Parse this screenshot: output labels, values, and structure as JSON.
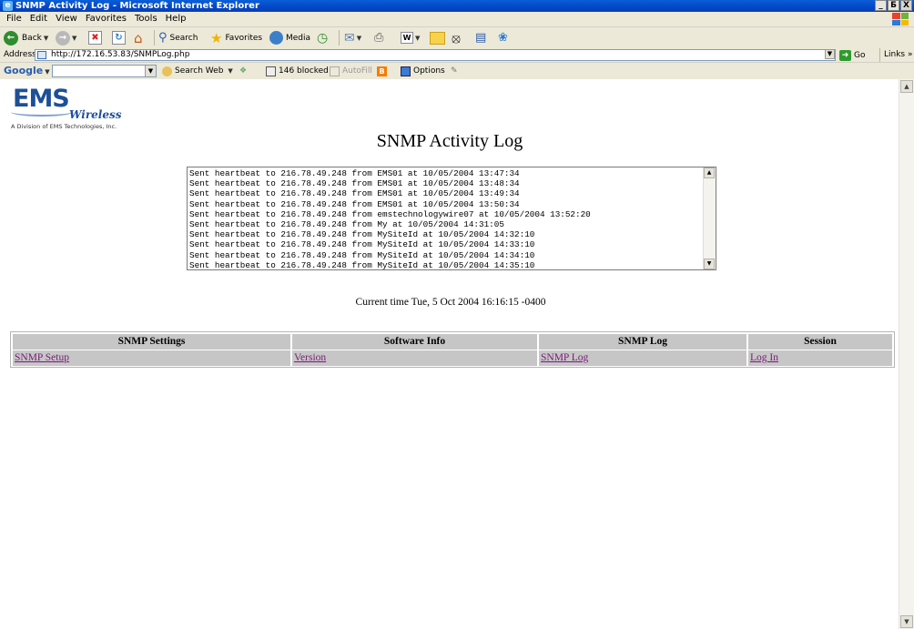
{
  "window": {
    "title": "SNMP Activity Log - Microsoft Internet Explorer",
    "buttons": [
      "_",
      "Б",
      "X"
    ]
  },
  "menu": [
    "File",
    "Edit",
    "View",
    "Favorites",
    "Tools",
    "Help"
  ],
  "toolbar": {
    "back": "Back",
    "search": "Search",
    "favorites": "Favorites",
    "media": "Media"
  },
  "address": {
    "label": "Address",
    "url": "http://172.16.53.83/SNMPLog.php",
    "go": "Go",
    "links": "Links"
  },
  "googlebar": {
    "logo": "Google",
    "search_web": "Search Web",
    "blocked": "146 blocked",
    "autofill": "AutoFill",
    "options": "Options"
  },
  "page": {
    "logo_text": "EMS",
    "logo_sub": "Wireless",
    "division": "A Division of EMS Technologies, Inc.",
    "title": "SNMP Activity Log",
    "log_lines": [
      "Sent heartbeat to 216.78.49.248 from EMS01 at 10/05/2004 13:47:34",
      "Sent heartbeat to 216.78.49.248 from EMS01 at 10/05/2004 13:48:34",
      "Sent heartbeat to 216.78.49.248 from EMS01 at 10/05/2004 13:49:34",
      "Sent heartbeat to 216.78.49.248 from EMS01 at 10/05/2004 13:50:34",
      "Sent heartbeat to 216.78.49.248 from emstechnologywire07 at 10/05/2004 13:52:20",
      "Sent heartbeat to 216.78.49.248 from My at 10/05/2004 14:31:05",
      "Sent heartbeat to 216.78.49.248 from MySiteId at 10/05/2004 14:32:10",
      "Sent heartbeat to 216.78.49.248 from MySiteId at 10/05/2004 14:33:10",
      "Sent heartbeat to 216.78.49.248 from MySiteId at 10/05/2004 14:34:10",
      "Sent heartbeat to 216.78.49.248 from MySiteId at 10/05/2004 14:35:10"
    ],
    "current_time": "Current time Tue, 5 Oct 2004 16:16:15 -0400",
    "nav": {
      "headers": [
        "SNMP Settings",
        "Software Info",
        "SNMP Log",
        "Session"
      ],
      "links": [
        "SNMP Setup",
        "Version",
        "SNMP Log",
        "Log In"
      ]
    }
  }
}
